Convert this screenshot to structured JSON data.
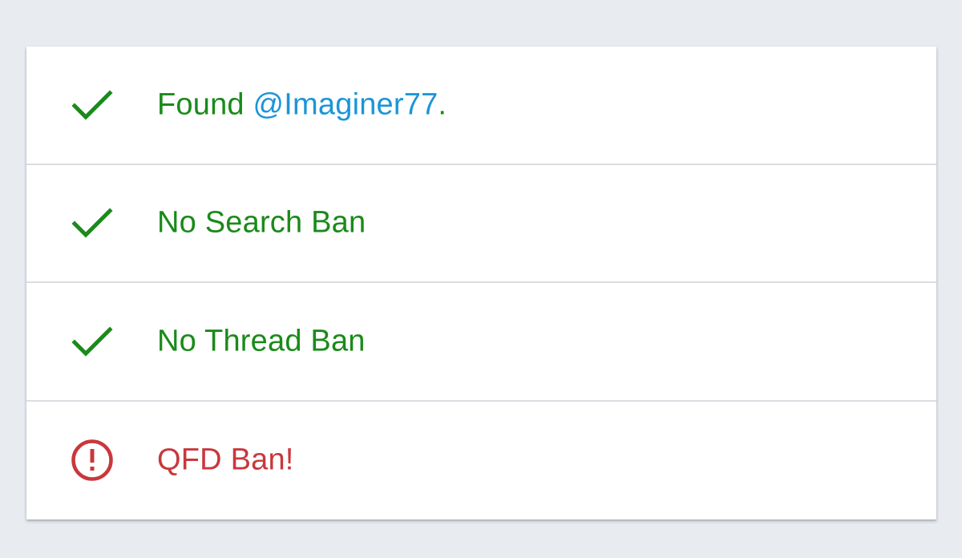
{
  "colors": {
    "background": "#e8ecf1",
    "ok": "#1a8a1a",
    "error": "#c8383c",
    "handle": "#1c95d8"
  },
  "results": [
    {
      "status": "ok",
      "icon": "check-icon",
      "prefix": "Found ",
      "handle": "@Imaginer77",
      "suffix": "."
    },
    {
      "status": "ok",
      "icon": "check-icon",
      "label": "No Search Ban"
    },
    {
      "status": "ok",
      "icon": "check-icon",
      "label": "No Thread Ban"
    },
    {
      "status": "error",
      "icon": "alert-circle-icon",
      "label": "QFD Ban!"
    }
  ]
}
